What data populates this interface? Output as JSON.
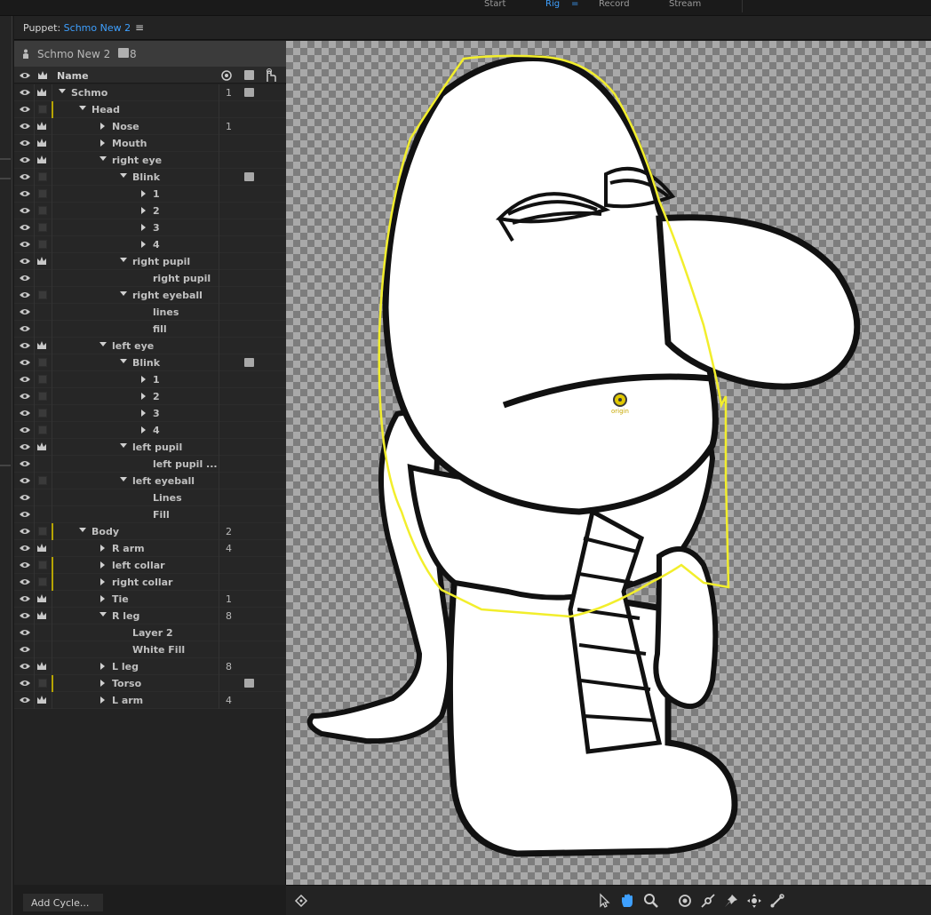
{
  "topbar": {
    "workspaces": [
      {
        "label": "Start",
        "active": false
      },
      {
        "label": "Rig",
        "active": true
      },
      {
        "label": "=",
        "active": true
      },
      {
        "label": "Record",
        "active": false
      },
      {
        "label": "Stream",
        "active": false
      }
    ]
  },
  "panel": {
    "tab_prefix": "Puppet: ",
    "tab_name": "Schmo New 2",
    "menu_icon": "hamburger-menu-icon"
  },
  "puppet": {
    "name": "Schmo New 2",
    "count": "8"
  },
  "columns": {
    "name": "Name"
  },
  "rows": [
    {
      "label": "Schmo",
      "indent": 0,
      "expander": "down",
      "crown": true,
      "num": "1",
      "tag": true,
      "yellow": false
    },
    {
      "label": "Head",
      "indent": 1,
      "expander": "down",
      "crown": false,
      "num": "",
      "tag": false,
      "yellow": true
    },
    {
      "label": "Nose",
      "indent": 2,
      "expander": "right",
      "crown": true,
      "num": "1",
      "tag": false,
      "yellow": false
    },
    {
      "label": "Mouth",
      "indent": 2,
      "expander": "right",
      "crown": true,
      "num": "",
      "tag": false,
      "yellow": false
    },
    {
      "label": "right eye",
      "indent": 2,
      "expander": "down",
      "crown": true,
      "num": "",
      "tag": false,
      "yellow": false
    },
    {
      "label": "Blink",
      "indent": 3,
      "expander": "down",
      "crown": false,
      "num": "",
      "tag": true,
      "yellow": false
    },
    {
      "label": "1",
      "indent": 4,
      "expander": "right",
      "crown": false,
      "num": "",
      "tag": false,
      "yellow": false
    },
    {
      "label": "2",
      "indent": 4,
      "expander": "right",
      "crown": false,
      "num": "",
      "tag": false,
      "yellow": false
    },
    {
      "label": "3",
      "indent": 4,
      "expander": "right",
      "crown": false,
      "num": "",
      "tag": false,
      "yellow": false
    },
    {
      "label": "4",
      "indent": 4,
      "expander": "right",
      "crown": false,
      "num": "",
      "tag": false,
      "yellow": false
    },
    {
      "label": "right pupil",
      "indent": 3,
      "expander": "down",
      "crown": true,
      "num": "",
      "tag": false,
      "yellow": false
    },
    {
      "label": "right pupil",
      "indent": 4,
      "expander": "none",
      "crown": false,
      "num": "",
      "tag": false,
      "yellow": false,
      "nobox": true
    },
    {
      "label": "right eyeball",
      "indent": 3,
      "expander": "down",
      "crown": false,
      "num": "",
      "tag": false,
      "yellow": false
    },
    {
      "label": "lines",
      "indent": 4,
      "expander": "none",
      "crown": false,
      "num": "",
      "tag": false,
      "yellow": false,
      "nobox": true
    },
    {
      "label": "fill",
      "indent": 4,
      "expander": "none",
      "crown": false,
      "num": "",
      "tag": false,
      "yellow": false,
      "nobox": true
    },
    {
      "label": "left eye",
      "indent": 2,
      "expander": "down",
      "crown": true,
      "num": "",
      "tag": false,
      "yellow": false
    },
    {
      "label": "Blink",
      "indent": 3,
      "expander": "down",
      "crown": false,
      "num": "",
      "tag": true,
      "yellow": false
    },
    {
      "label": "1",
      "indent": 4,
      "expander": "right",
      "crown": false,
      "num": "",
      "tag": false,
      "yellow": false
    },
    {
      "label": "2",
      "indent": 4,
      "expander": "right",
      "crown": false,
      "num": "",
      "tag": false,
      "yellow": false
    },
    {
      "label": "3",
      "indent": 4,
      "expander": "right",
      "crown": false,
      "num": "",
      "tag": false,
      "yellow": false
    },
    {
      "label": "4",
      "indent": 4,
      "expander": "right",
      "crown": false,
      "num": "",
      "tag": false,
      "yellow": false
    },
    {
      "label": "left pupil",
      "indent": 3,
      "expander": "down",
      "crown": true,
      "num": "",
      "tag": false,
      "yellow": false
    },
    {
      "label": "left pupil ...",
      "indent": 4,
      "expander": "none",
      "crown": false,
      "num": "",
      "tag": false,
      "yellow": false,
      "nobox": true
    },
    {
      "label": "left eyeball",
      "indent": 3,
      "expander": "down",
      "crown": false,
      "num": "",
      "tag": false,
      "yellow": false
    },
    {
      "label": "Lines",
      "indent": 4,
      "expander": "none",
      "crown": false,
      "num": "",
      "tag": false,
      "yellow": false,
      "nobox": true
    },
    {
      "label": "Fill",
      "indent": 4,
      "expander": "none",
      "crown": false,
      "num": "",
      "tag": false,
      "yellow": false,
      "nobox": true
    },
    {
      "label": "Body",
      "indent": 1,
      "expander": "down",
      "crown": false,
      "num": "2",
      "tag": false,
      "yellow": true
    },
    {
      "label": "R arm",
      "indent": 2,
      "expander": "right",
      "crown": true,
      "num": "4",
      "tag": false,
      "yellow": false
    },
    {
      "label": "left collar",
      "indent": 2,
      "expander": "right",
      "crown": false,
      "num": "",
      "tag": false,
      "yellow": true
    },
    {
      "label": "right collar",
      "indent": 2,
      "expander": "right",
      "crown": false,
      "num": "",
      "tag": false,
      "yellow": true
    },
    {
      "label": "Tie",
      "indent": 2,
      "expander": "right",
      "crown": true,
      "num": "1",
      "tag": false,
      "yellow": false
    },
    {
      "label": "R leg",
      "indent": 2,
      "expander": "down",
      "crown": true,
      "num": "8",
      "tag": false,
      "yellow": false
    },
    {
      "label": "Layer 2",
      "indent": 3,
      "expander": "none",
      "crown": false,
      "num": "",
      "tag": false,
      "yellow": false,
      "nobox": true
    },
    {
      "label": "White Fill",
      "indent": 3,
      "expander": "none",
      "crown": false,
      "num": "",
      "tag": false,
      "yellow": false,
      "nobox": true
    },
    {
      "label": "L leg",
      "indent": 2,
      "expander": "right",
      "crown": true,
      "num": "8",
      "tag": false,
      "yellow": false
    },
    {
      "label": "Torso",
      "indent": 2,
      "expander": "right",
      "crown": false,
      "num": "",
      "tag": true,
      "yellow": true
    },
    {
      "label": "L arm",
      "indent": 2,
      "expander": "right",
      "crown": true,
      "num": "4",
      "tag": false,
      "yellow": false
    }
  ],
  "add_cycle": "Add Cycle...",
  "canvas": {
    "origin_label": "origin",
    "outline_color": "#f2ee2c",
    "accent": "#3ea0ff"
  },
  "tools": [
    "puppet-icon",
    "select-arrow-icon",
    "hand-icon",
    "zoom-icon",
    "origin-icon",
    "dragger-icon",
    "pin-icon",
    "transform-icon",
    "stick-icon"
  ]
}
